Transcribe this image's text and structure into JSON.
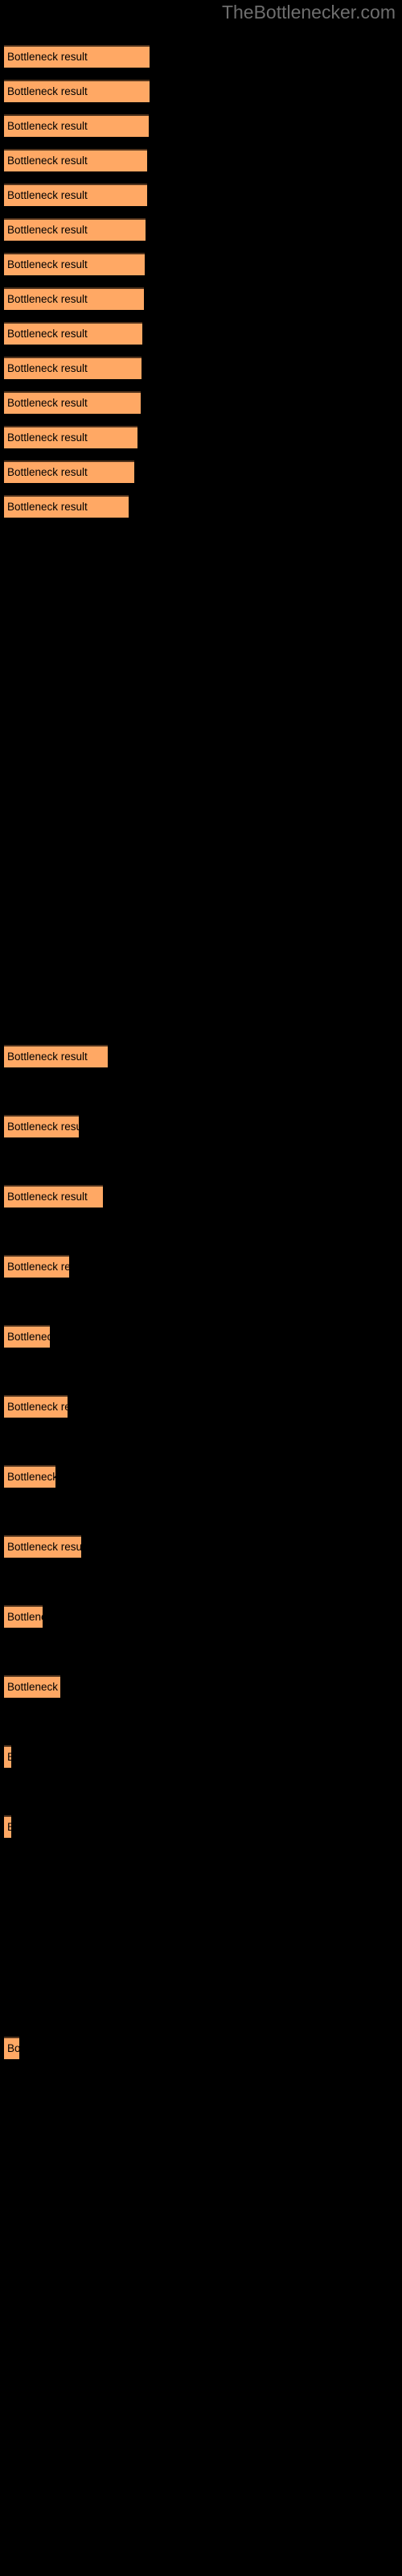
{
  "site": {
    "title": "TheBottlenecker.com",
    "title_color": "#6e6e6e"
  },
  "chart_data": {
    "type": "bar",
    "orientation": "horizontal",
    "title": "TheBottlenecker.com",
    "xlabel": "",
    "ylabel": "",
    "grid": false,
    "legend": null,
    "bar_color": "#ffa864",
    "bar_border_color": "#51331c",
    "background": "#000000",
    "label_color": "#000000",
    "bar_label_text": "Bottleneck result",
    "xlim": [
      0,
      500
    ],
    "categories": [
      "Bottleneck result",
      "Bottleneck result",
      "Bottleneck result",
      "Bottleneck result",
      "Bottleneck result",
      "Bottleneck result",
      "Bottleneck result",
      "Bottleneck result",
      "Bottleneck result",
      "Bottleneck result",
      "Bottleneck result",
      "Bottleneck result",
      "Bottleneck result",
      "Bottleneck result",
      "Bottleneck result",
      "Bottleneck result",
      "Bottleneck result",
      "Bottleneck result",
      "Bottleneck result",
      "Bottleneck result",
      "Bottleneck result",
      "Bottleneck result",
      "Bottleneck result",
      "Bottleneck result",
      "Bottleneck result",
      "Bottleneck result",
      "Bottleneck result"
    ],
    "values": [
      181,
      181,
      180,
      178,
      178,
      176,
      175,
      174,
      172,
      171,
      170,
      166,
      162,
      155,
      129,
      93,
      123,
      81,
      57,
      79,
      64,
      96,
      48,
      70,
      9,
      9,
      19
    ],
    "bars": [
      {
        "label": "Bottleneck result",
        "value": 181,
        "y": 56,
        "width": 181
      },
      {
        "label": "Bottleneck result",
        "value": 181,
        "y": 99,
        "width": 181
      },
      {
        "label": "Bottleneck result",
        "value": 180,
        "y": 142,
        "width": 180
      },
      {
        "label": "Bottleneck result",
        "value": 178,
        "y": 185,
        "width": 178
      },
      {
        "label": "Bottleneck result",
        "value": 178,
        "y": 228,
        "width": 178
      },
      {
        "label": "Bottleneck result",
        "value": 176,
        "y": 271,
        "width": 176
      },
      {
        "label": "Bottleneck result",
        "value": 175,
        "y": 314,
        "width": 175
      },
      {
        "label": "Bottleneck result",
        "value": 174,
        "y": 357,
        "width": 174
      },
      {
        "label": "Bottleneck result",
        "value": 172,
        "y": 400,
        "width": 172
      },
      {
        "label": "Bottleneck result",
        "value": 171,
        "y": 443,
        "width": 171
      },
      {
        "label": "Bottleneck result",
        "value": 170,
        "y": 486,
        "width": 170
      },
      {
        "label": "Bottleneck result",
        "value": 166,
        "y": 529,
        "width": 166
      },
      {
        "label": "Bottleneck result",
        "value": 162,
        "y": 572,
        "width": 162
      },
      {
        "label": "Bottleneck result",
        "value": 155,
        "y": 615,
        "width": 155
      },
      {
        "label": "Bottleneck result",
        "value": 129,
        "y": 1298,
        "width": 129
      },
      {
        "label": "Bottleneck result",
        "value": 93,
        "y": 1385,
        "width": 93
      },
      {
        "label": "Bottleneck result",
        "value": 123,
        "y": 1472,
        "width": 123
      },
      {
        "label": "Bottleneck result",
        "value": 81,
        "y": 1559,
        "width": 81
      },
      {
        "label": "Bottleneck result",
        "value": 57,
        "y": 1646,
        "width": 57
      },
      {
        "label": "Bottleneck result",
        "value": 79,
        "y": 1733,
        "width": 79
      },
      {
        "label": "Bottleneck result",
        "value": 64,
        "y": 1820,
        "width": 64
      },
      {
        "label": "Bottleneck result",
        "value": 96,
        "y": 1907,
        "width": 96
      },
      {
        "label": "Bottleneck result",
        "value": 48,
        "y": 1994,
        "width": 48
      },
      {
        "label": "Bottleneck result",
        "value": 70,
        "y": 2081,
        "width": 70
      },
      {
        "label": "Bottleneck result",
        "value": 9,
        "y": 2168,
        "width": 9
      },
      {
        "label": "Bottleneck result",
        "value": 9,
        "y": 2255,
        "width": 9
      },
      {
        "label": "Bottleneck result",
        "value": 19,
        "y": 2530,
        "width": 19
      }
    ]
  }
}
